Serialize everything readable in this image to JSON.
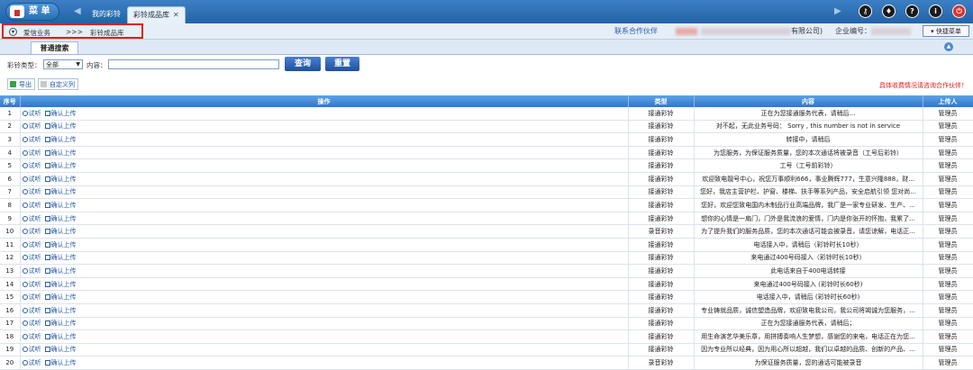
{
  "topbar": {
    "menu_label": "菜 单",
    "tabs": [
      {
        "label": "我的彩铃",
        "active": false
      },
      {
        "label": "彩铃成品库",
        "active": true
      }
    ],
    "icons": [
      "key-icon",
      "shirt-icon",
      "help-icon",
      "info-icon",
      "power-icon"
    ]
  },
  "breadcrumb": {
    "items": [
      "爱信业务",
      "彩铃成品库"
    ],
    "separator": ">>>"
  },
  "header_info": {
    "partner_label": "联系合作伙伴",
    "company_suffix": "有限公司)",
    "company_no_label": "企业编号：",
    "quick_menu": "快捷菜单"
  },
  "search": {
    "tab_label": "普通搜索",
    "type_label": "彩铃类型：",
    "type_value": "全部",
    "content_label": "内容：",
    "content_value": "",
    "query_button": "查询",
    "reset_button": "重置"
  },
  "toolbar": {
    "export_label": "导出",
    "custom_cols_label": "自定义列",
    "notice": "具体收费情况请咨询合作伙伴！"
  },
  "table": {
    "headers": [
      "序号",
      "操作",
      "类型",
      "内容",
      "上传人"
    ],
    "listen_label": "试听",
    "confirm_label": "确认上传",
    "rows": [
      {
        "no": "1",
        "type": "接通彩铃",
        "content": "正在为您接通服务代表，请稍后...",
        "uploader": "管理员"
      },
      {
        "no": "2",
        "type": "接通彩铃",
        "content": "对不起，无此业务号码： Sorry , this number is not in service",
        "uploader": "管理员"
      },
      {
        "no": "3",
        "type": "接通彩铃",
        "content": "转接中，请稍后",
        "uploader": "管理员"
      },
      {
        "no": "4",
        "type": "接通彩铃",
        "content": "为您服务，为保证服务质量，您的本次通话将被录音（工号后彩铃）",
        "uploader": "管理员"
      },
      {
        "no": "5",
        "type": "接通彩铃",
        "content": "工号（工号前彩铃）",
        "uploader": "管理员"
      },
      {
        "no": "6",
        "type": "接通彩铃",
        "content": "欢迎致电靓号中心，祝您万事顺利666，事业腾辉777，生意兴隆888，财...",
        "uploader": "管理员"
      },
      {
        "no": "7",
        "type": "接通彩铃",
        "content": "您好，我店主营护栏、护窗、楼梯、扶手等系列产品，安全启航引领 您对尚...",
        "uploader": "管理员"
      },
      {
        "no": "8",
        "type": "接通彩铃",
        "content": "您好，欢迎您致电国内木制品行业高端品牌，我厂是一家专业研发、生产、...",
        "uploader": "管理员"
      },
      {
        "no": "9",
        "type": "接通彩铃",
        "content": "想你的心情是一扇门，门外是我流浪的爱情，门内是你张开的怀抱，我累了...",
        "uploader": "管理员"
      },
      {
        "no": "10",
        "type": "录音彩铃",
        "content": "为了提升我们的服务品质，您的本次通话可能会被录音，请您谅解，电话正...",
        "uploader": "管理员"
      },
      {
        "no": "11",
        "type": "接通彩铃",
        "content": "电话接入中，请稍后（彩铃时长10秒）",
        "uploader": "管理员"
      },
      {
        "no": "12",
        "type": "接通彩铃",
        "content": "来电通过400号码接入（彩铃时长10秒）",
        "uploader": "管理员"
      },
      {
        "no": "13",
        "type": "接通彩铃",
        "content": "此电话来自于400电话转接",
        "uploader": "管理员"
      },
      {
        "no": "14",
        "type": "接通彩铃",
        "content": "来电通过400号码接入 (彩铃时长60秒)",
        "uploader": "管理员"
      },
      {
        "no": "15",
        "type": "接通彩铃",
        "content": "电话接入中，请稍后 (彩铃时长60秒)",
        "uploader": "管理员"
      },
      {
        "no": "16",
        "type": "接通彩铃",
        "content": "专业铸就品质，诚信塑造品牌，欢迎致电我公司，我公司将竭诚为您服务，...",
        "uploader": "管理员"
      },
      {
        "no": "17",
        "type": "接通彩铃",
        "content": "正在为您接通服务代表，请稍后；",
        "uploader": "管理员"
      },
      {
        "no": "18",
        "type": "接通彩铃",
        "content": "用生命演艺华美乐章，用拼搏奏响人生梦想，感谢您的来电，电话正在为您...",
        "uploader": "管理员"
      },
      {
        "no": "19",
        "type": "接通彩铃",
        "content": "因为专业所以经典，因为用心所以超越，我们以卓越的品质、创新的产品、...",
        "uploader": "管理员"
      },
      {
        "no": "20",
        "type": "录音彩铃",
        "content": "为保证服务质量，您的通话可能被录音",
        "uploader": "管理员"
      }
    ]
  }
}
